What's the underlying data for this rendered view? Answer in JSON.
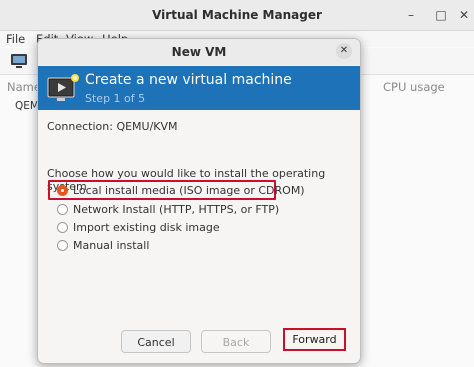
{
  "main_window": {
    "title": "Virtual Machine Manager",
    "controls": [
      "–",
      "□",
      "✕"
    ],
    "menu": [
      "File",
      "Edit",
      "View",
      "Help"
    ],
    "columns": {
      "name": "Name",
      "cpu": "CPU usage"
    },
    "rows": [
      "QEMU"
    ]
  },
  "dialog": {
    "title": "New VM",
    "close_glyph": "✕",
    "banner": {
      "title": "Create a new virtual machine",
      "step": "Step 1 of 5",
      "color": "#1e72b8"
    },
    "connection_label": "Connection:",
    "connection_value": "QEMU/KVM",
    "question": "Choose how you would like to install the operating system",
    "options": [
      {
        "label": "Local install media (ISO image or CDROM)",
        "selected": true
      },
      {
        "label": "Network Install (HTTP, HTTPS, or FTP)",
        "selected": false
      },
      {
        "label": "Import existing disk image",
        "selected": false
      },
      {
        "label": "Manual install",
        "selected": false
      }
    ],
    "buttons": {
      "cancel": "Cancel",
      "back": "Back",
      "forward": "Forward"
    },
    "accent_color": "#e95420",
    "annotation_color": "#c8102e"
  }
}
